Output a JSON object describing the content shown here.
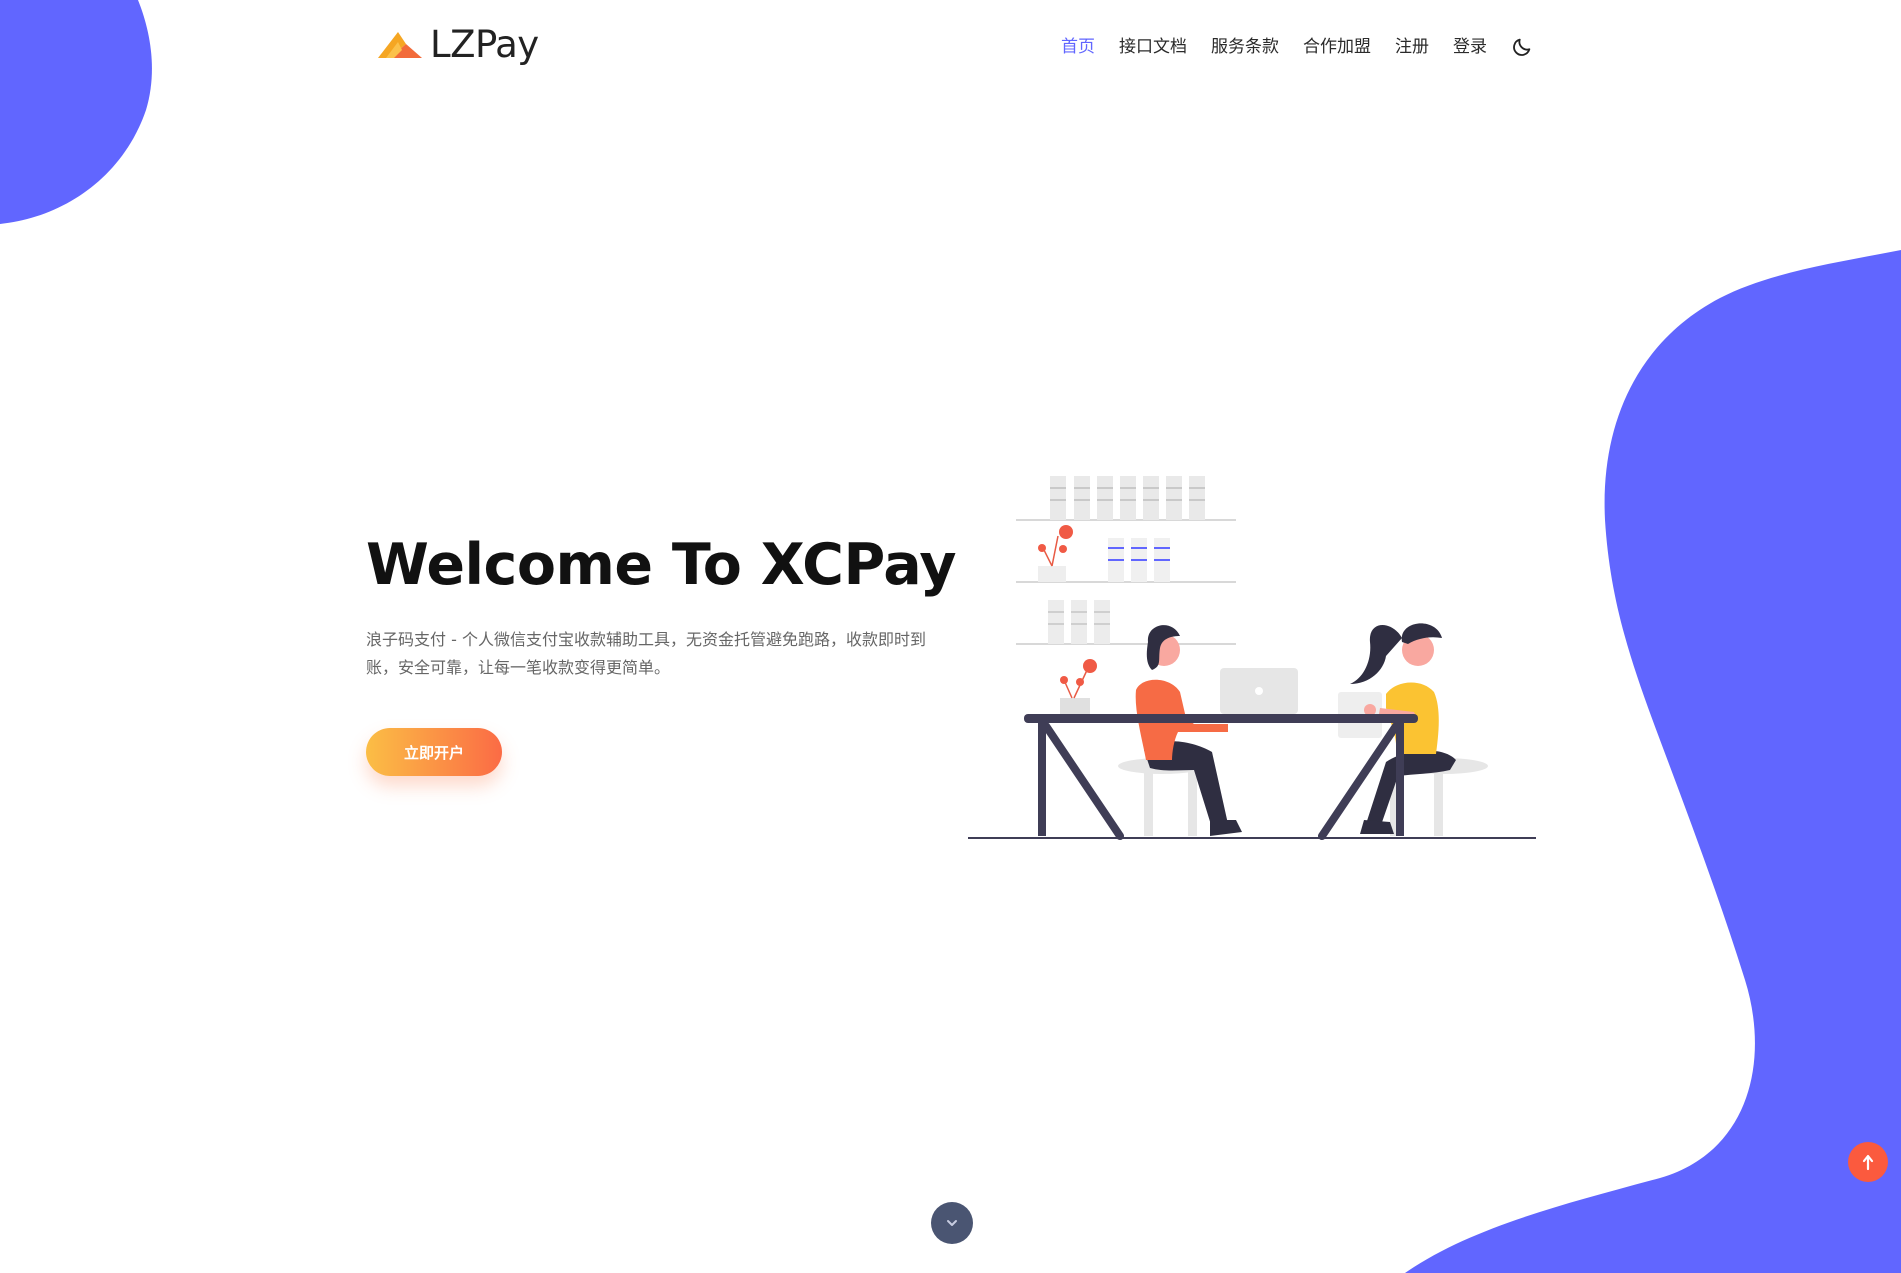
{
  "header": {
    "logo_text_bold": "LZ",
    "logo_text_light": "Pay",
    "nav": [
      {
        "label": "首页",
        "active": true
      },
      {
        "label": "接口文档"
      },
      {
        "label": "服务条款"
      },
      {
        "label": "合作加盟"
      },
      {
        "label": "注册"
      },
      {
        "label": "登录"
      }
    ],
    "theme_icon": "moon-icon"
  },
  "hero": {
    "title": "Welcome To XCPay",
    "description": "浪子码支付 - 个人微信支付宝收款辅助工具，无资金托管避免跑路，收款即时到账，安全可靠，让每一笔收款变得更简单。",
    "cta_label": "立即开户"
  },
  "icons": {
    "scroll_down": "chevron-down-icon",
    "back_to_top": "arrow-up-icon"
  },
  "colors": {
    "accent": "#6166ff",
    "cta_start": "#fbbe45",
    "cta_end": "#fb6b45",
    "blob": "#6166ff"
  }
}
